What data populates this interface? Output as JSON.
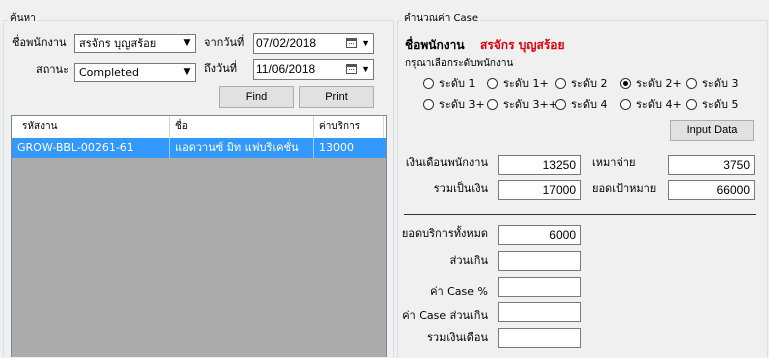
{
  "search": {
    "title": "ค้นหา",
    "employee_label": "ชื่อพนักงาน",
    "employee_value": "สรจักร บุญสร้อย",
    "status_label": "สถานะ",
    "status_value": "Completed",
    "from_label": "จากวันที่",
    "from_date": "07/02/2018",
    "to_label": "ถึงวันที่",
    "to_date": "11/06/2018",
    "find_label": "Find",
    "print_label": "Print"
  },
  "grid": {
    "columns": [
      "รหัสงาน",
      "ชื่อ",
      "ค่าบริการ"
    ],
    "rows": [
      {
        "code": "GROW-BBL-00261-61",
        "name": "แอดวานซ์ มิท แฟบริเคชั่น",
        "fee": "13000"
      }
    ]
  },
  "calc": {
    "title": "คำนวณค่า Case",
    "employee_label": "ชื่อพนักงาน",
    "employee_name": "สรจักร บุญสร้อย",
    "level_prompt": "กรุณาเลือกระดับพนักงาน",
    "levels": [
      "ระดับ 1",
      "ระดับ 1+",
      "ระดับ 2",
      "ระดับ 2+",
      "ระดับ 3",
      "ระดับ 3+",
      "ระดับ 3++",
      "ระดับ 4",
      "ระดับ 4+",
      "ระดับ 5"
    ],
    "selected_level": "ระดับ 2+",
    "input_button": "Input Data",
    "salary_label": "เงินเดือนพนักงาน",
    "salary_value": "13250",
    "lump_label": "เหมาจ่าย",
    "lump_value": "3750",
    "total_label": "รวมเป็นเงิน",
    "total_value": "17000",
    "target_label": "ยอดเป้าหมาย",
    "target_value": "66000",
    "service_total_label": "ยอดบริการทั้งหมด",
    "service_total_value": "6000",
    "excess_label": "ส่วนเกิน",
    "excess_value": "",
    "case_pct_label": "ค่า Case %",
    "case_pct_value": "",
    "case_excess_label": "ค่า Case ส่วนเกิน",
    "case_excess_value": "",
    "total_salary_label": "รวมเงินเดือน",
    "total_salary_value": ""
  },
  "colors": {
    "employee_name": "#e0000f",
    "selection": "#3399ff",
    "focus_border": "#0078d7"
  }
}
